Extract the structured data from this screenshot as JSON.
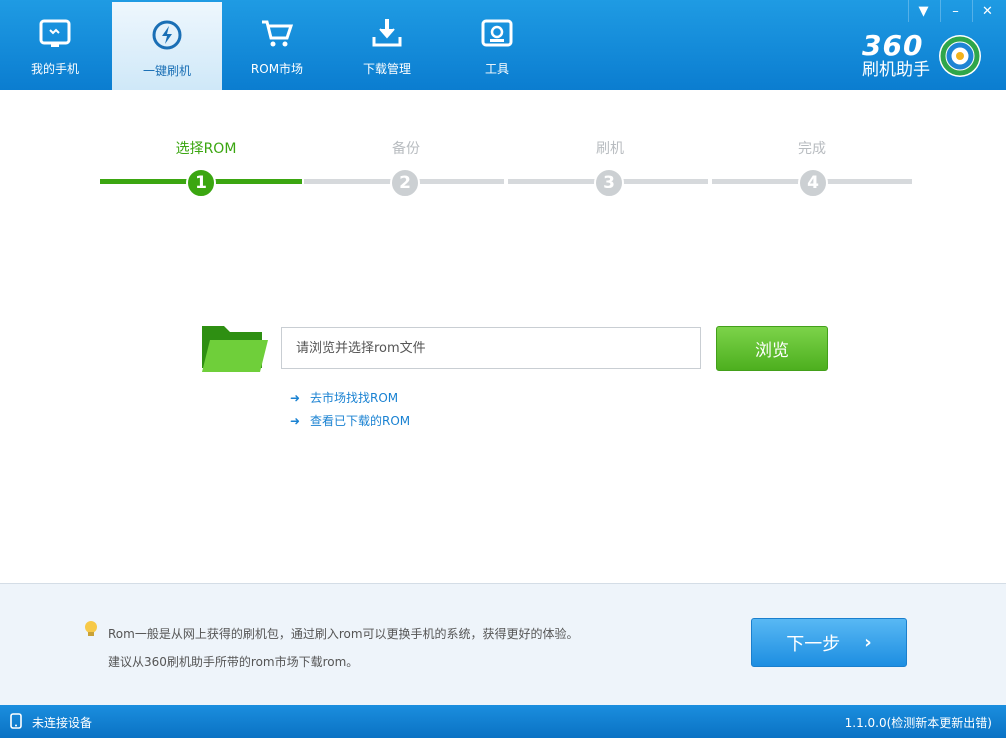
{
  "tabs": [
    {
      "label": "我的手机",
      "icon": "phone-icon"
    },
    {
      "label": "一键刷机",
      "icon": "flash-icon"
    },
    {
      "label": "ROM市场",
      "icon": "cart-icon"
    },
    {
      "label": "下载管理",
      "icon": "download-icon"
    },
    {
      "label": "工具",
      "icon": "toolbox-icon"
    }
  ],
  "window_controls": {
    "menu": "▼",
    "minimize": "–",
    "close": "✕"
  },
  "logo": {
    "number": "360",
    "name": "刷机助手"
  },
  "steps": [
    {
      "label": "选择ROM",
      "number": "1",
      "status": "active"
    },
    {
      "label": "备份",
      "number": "2",
      "status": "inactive"
    },
    {
      "label": "刷机",
      "number": "3",
      "status": "inactive"
    },
    {
      "label": "完成",
      "number": "4",
      "status": "inactive"
    }
  ],
  "rom_input": {
    "placeholder": "请浏览并选择rom文件",
    "value": ""
  },
  "browse_button": "浏览",
  "links": [
    {
      "label": "去市场找找ROM"
    },
    {
      "label": "查看已下载的ROM"
    }
  ],
  "tips": [
    "Rom一般是从网上获得的刷机包，通过刷入rom可以更换手机的系统，获得更好的体验。",
    "建议从360刷机助手所带的rom市场下载rom。"
  ],
  "next_button": "下一步",
  "status": {
    "device": "未连接设备",
    "version": "1.1.0.0(检测新本更新出错)"
  },
  "colors": {
    "brand_blue": "#0b7dd0",
    "accent_green": "#3ba611",
    "link_blue": "#1a82d2"
  }
}
